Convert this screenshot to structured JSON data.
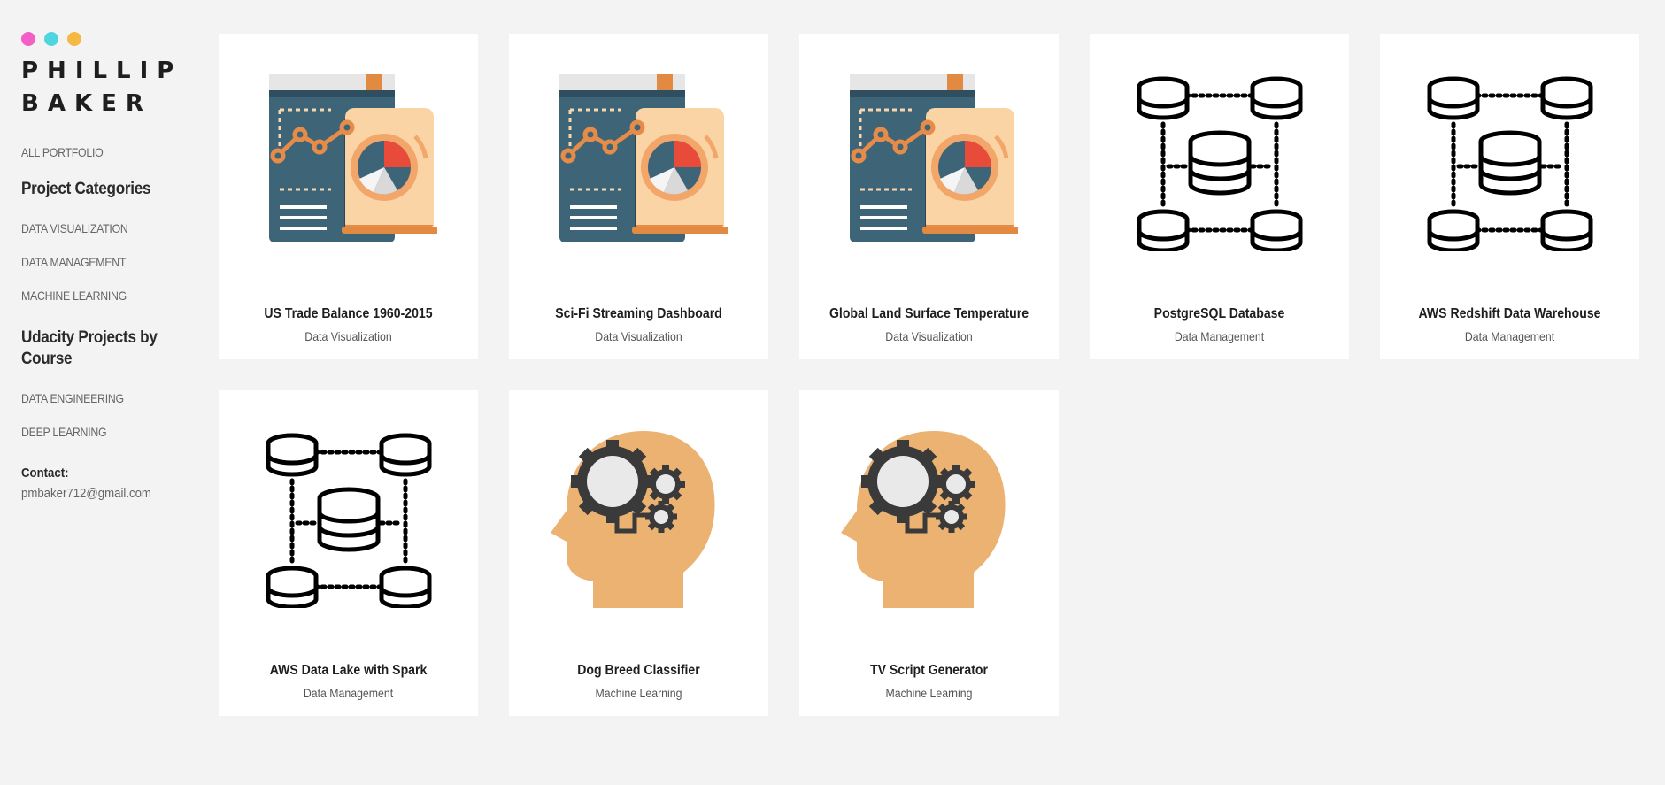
{
  "brand": {
    "dots": [
      "#f35fc6",
      "#4fd5dd",
      "#f5b843"
    ],
    "line1": "PHILLIP",
    "line2": "BAKER"
  },
  "sidebar": {
    "all_portfolio": "ALL PORTFOLIO",
    "categories_heading": "Project Categories",
    "categories": [
      "DATA VISUALIZATION",
      "DATA MANAGEMENT",
      "MACHINE LEARNING"
    ],
    "courses_heading": "Udacity Projects by Course",
    "courses": [
      "DATA ENGINEERING",
      "DEEP LEARNING"
    ],
    "contact_label": "Contact:",
    "contact_email": "pmbaker712@gmail.com"
  },
  "projects": [
    {
      "title": "US Trade Balance 1960-2015",
      "category": "Data Visualization",
      "icon": "report-chart-icon"
    },
    {
      "title": "Sci-Fi Streaming Dashboard",
      "category": "Data Visualization",
      "icon": "report-chart-icon"
    },
    {
      "title": "Global Land Surface Temperature",
      "category": "Data Visualization",
      "icon": "report-chart-icon"
    },
    {
      "title": "PostgreSQL Database",
      "category": "Data Management",
      "icon": "database-network-icon"
    },
    {
      "title": "AWS Redshift Data Warehouse",
      "category": "Data Management",
      "icon": "database-network-icon"
    },
    {
      "title": "AWS Data Lake with Spark",
      "category": "Data Management",
      "icon": "database-network-icon"
    },
    {
      "title": "Dog Breed Classifier",
      "category": "Machine Learning",
      "icon": "head-gears-icon"
    },
    {
      "title": "TV Script Generator",
      "category": "Machine Learning",
      "icon": "head-gears-icon"
    }
  ]
}
